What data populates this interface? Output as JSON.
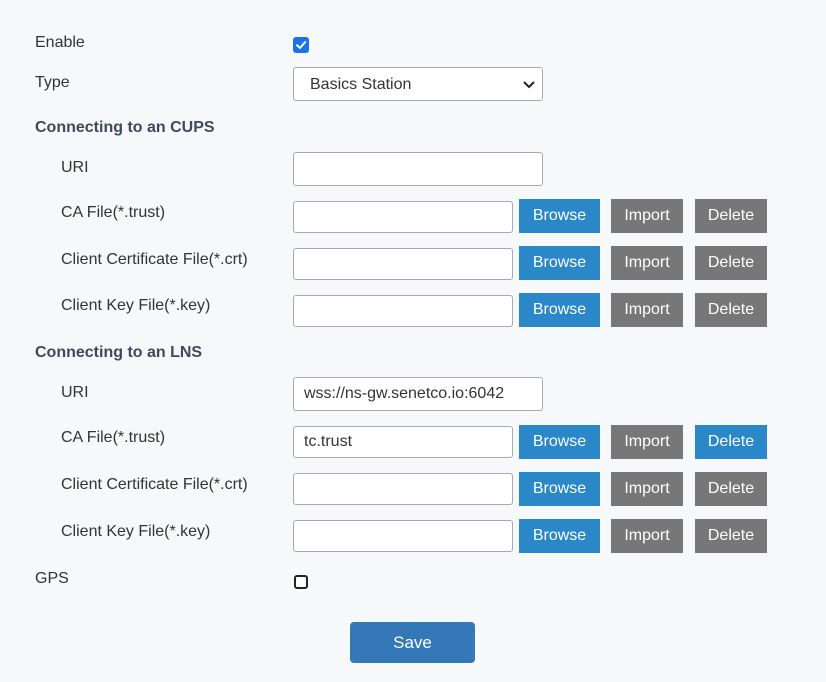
{
  "enable": {
    "label": "Enable",
    "checked": true
  },
  "type": {
    "label": "Type",
    "selected": "Basics Station"
  },
  "cups": {
    "title": "Connecting to an CUPS",
    "uri": {
      "label": "URI",
      "value": ""
    },
    "ca_file": {
      "label": "CA File(*.trust)",
      "value": "",
      "browse": "Browse",
      "import": "Import",
      "delete": "Delete"
    },
    "client_cert": {
      "label": "Client Certificate File(*.crt)",
      "value": "",
      "browse": "Browse",
      "import": "Import",
      "delete": "Delete"
    },
    "client_key": {
      "label": "Client Key File(*.key)",
      "value": "",
      "browse": "Browse",
      "import": "Import",
      "delete": "Delete"
    }
  },
  "lns": {
    "title": "Connecting to an LNS",
    "uri": {
      "label": "URI",
      "value": "wss://ns-gw.senetco.io:6042"
    },
    "ca_file": {
      "label": "CA File(*.trust)",
      "value": "tc.trust",
      "browse": "Browse",
      "import": "Import",
      "delete": "Delete"
    },
    "client_cert": {
      "label": "Client Certificate File(*.crt)",
      "value": "",
      "browse": "Browse",
      "import": "Import",
      "delete": "Delete"
    },
    "client_key": {
      "label": "Client Key File(*.key)",
      "value": "",
      "browse": "Browse",
      "import": "Import",
      "delete": "Delete"
    }
  },
  "gps": {
    "label": "GPS",
    "checked": false
  },
  "save_label": "Save",
  "colors": {
    "primary_button": "#2a87c8",
    "secondary_button": "#777777",
    "save_button": "#3578b8",
    "checkbox_checked": "#1a73e8",
    "section_title": "#3d4a5c",
    "background": "#f7f8fa"
  }
}
